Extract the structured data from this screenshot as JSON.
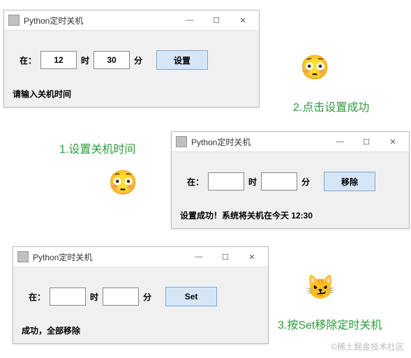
{
  "windows": {
    "win1": {
      "title": "Python定时关机",
      "label_at": "在：",
      "hour_value": "12",
      "label_hour": "时",
      "minute_value": "30",
      "label_minute": "分",
      "button": "设置",
      "status": "请输入关机时间"
    },
    "win2": {
      "title": "Python定时关机",
      "label_at": "在：",
      "hour_value": "",
      "label_hour": "时",
      "minute_value": "",
      "label_minute": "分",
      "button": "移除",
      "status": "设置成功！系统将关机在今天 12:30"
    },
    "win3": {
      "title": "Python定时关机",
      "label_at": "在：",
      "hour_value": "",
      "label_hour": "时",
      "minute_value": "",
      "label_minute": "分",
      "button": "Set",
      "status": "成功，全部移除"
    }
  },
  "captions": {
    "c1": "1.设置关机时间",
    "c2": "2.点击设置成功",
    "c3": "3.按Set移除定时关机"
  },
  "window_controls": {
    "minimize": "—",
    "maximize": "☐",
    "close": "✕"
  },
  "emojis": {
    "e1": "😳",
    "e2": "😳",
    "e3": "😼"
  },
  "watermark": "©稀土掘金技术社区"
}
